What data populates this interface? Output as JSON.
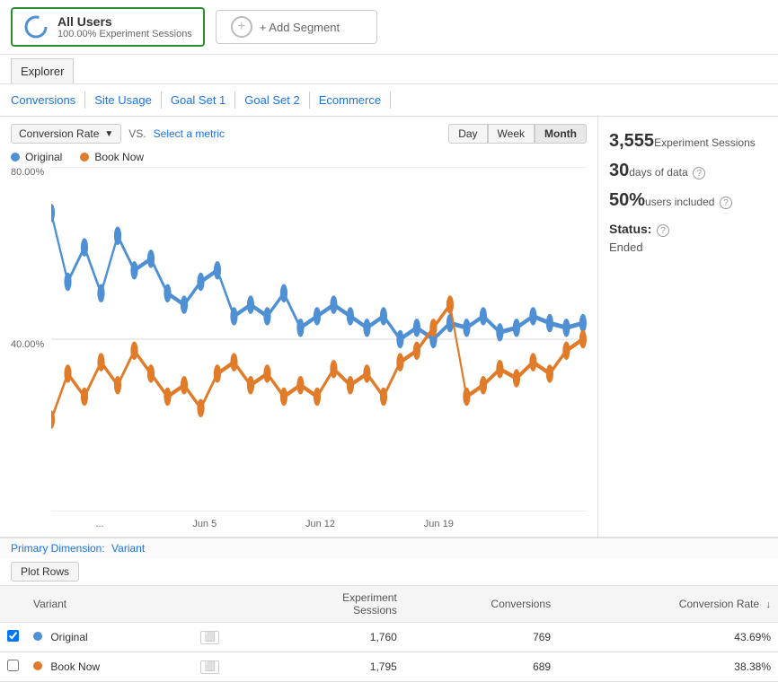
{
  "segment": {
    "name": "All Users",
    "sub": "100.00% Experiment Sessions",
    "add_label": "+ Add Segment"
  },
  "tabs": {
    "explorer": "Explorer"
  },
  "subnav": {
    "items": [
      {
        "label": "Conversions",
        "active": false
      },
      {
        "label": "Site Usage",
        "active": false
      },
      {
        "label": "Goal Set 1",
        "active": false
      },
      {
        "label": "Goal Set 2",
        "active": false
      },
      {
        "label": "Ecommerce",
        "active": false
      }
    ]
  },
  "chart": {
    "metric_dropdown": "Conversion Rate",
    "vs_label": "VS.",
    "select_metric": "Select a metric",
    "time_buttons": [
      "Day",
      "Week",
      "Month"
    ],
    "active_time": "Month",
    "legend": [
      {
        "label": "Original",
        "color": "#4e90d3"
      },
      {
        "label": "Book Now",
        "color": "#e07b29"
      }
    ],
    "y_labels": [
      "80.00%",
      "40.00%",
      ""
    ],
    "x_labels": [
      "...",
      "Jun 5",
      "Jun 12",
      "Jun 19",
      ""
    ]
  },
  "right_panel": {
    "experiment_sessions_number": "3,555",
    "experiment_sessions_label": "Experiment Sessions",
    "days_number": "30",
    "days_label": "days of data",
    "users_number": "50%",
    "users_label": "users included",
    "status_label": "Status:",
    "status_value": "Ended"
  },
  "primary_dimension": {
    "label": "Primary Dimension:",
    "value": "Variant"
  },
  "plot_rows_button": "Plot Rows",
  "table": {
    "headers": [
      {
        "label": "",
        "type": "checkbox"
      },
      {
        "label": "Variant",
        "type": "text"
      },
      {
        "label": "",
        "type": "icon"
      },
      {
        "label": "Experiment Sessions",
        "type": "number"
      },
      {
        "label": "Conversions",
        "type": "number"
      },
      {
        "label": "Conversion Rate",
        "type": "number",
        "sort": true
      }
    ],
    "rows": [
      {
        "checkbox": true,
        "dot_color": "#4e90d3",
        "variant": "Original",
        "experiment_sessions": "1,760",
        "conversions": "769",
        "conversion_rate": "43.69%"
      },
      {
        "checkbox": false,
        "dot_color": "#e07b29",
        "variant": "Book Now",
        "experiment_sessions": "1,795",
        "conversions": "689",
        "conversion_rate": "38.38%"
      }
    ]
  }
}
